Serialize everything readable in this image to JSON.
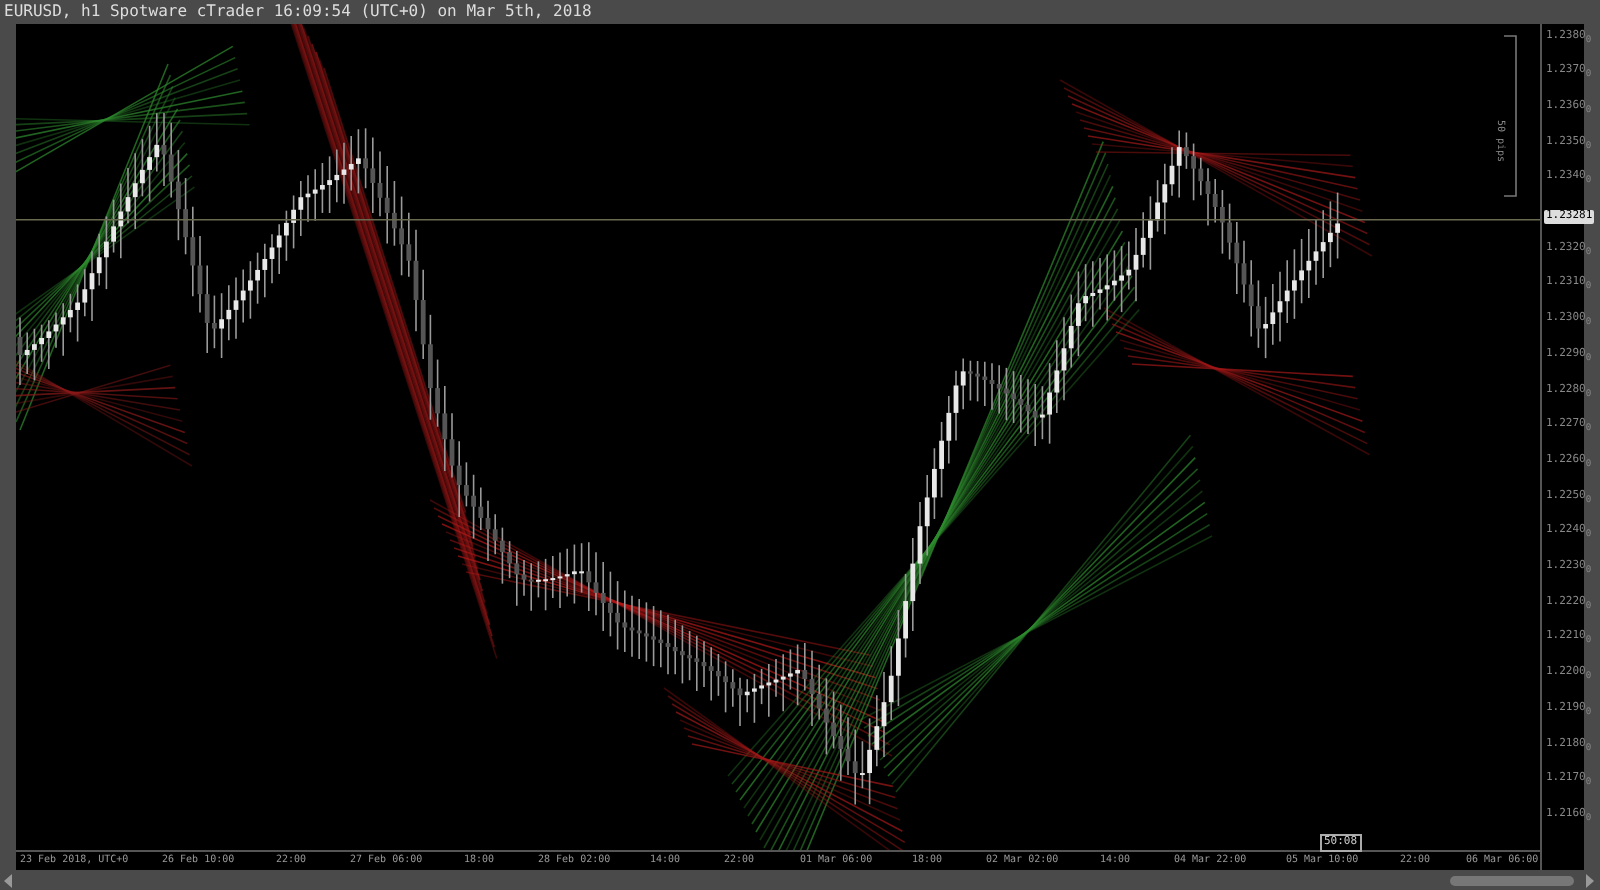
{
  "window": {
    "title": "EURUSD, h1 Spotware cTrader 16:09:54 (UTC+0) on Mar 5th, 2018"
  },
  "chart": {
    "ruler_label": "50 pips",
    "current_price": "1.23281",
    "countdown": "50:08",
    "price_axis": [
      "1.2380$_{0}$",
      "1.2370$_{0}$",
      "1.2360$_{0}$",
      "1.2350$_{0}$",
      "1.2340$_{0}$",
      "1.2320$_{0}$",
      "1.2310$_{0}$",
      "1.2300$_{0}$",
      "1.2290$_{0}$",
      "1.2280$_{0}$",
      "1.2270$_{0}$",
      "1.2260$_{0}$",
      "1.2250$_{0}$",
      "1.2240$_{0}$",
      "1.2230$_{0}$",
      "1.2220$_{0}$",
      "1.2210$_{0}$",
      "1.2200$_{0}$",
      "1.2190$_{0}$",
      "1.2180$_{0}$",
      "1.2170$_{0}$",
      "1.2160$_{0}$"
    ],
    "time_axis": [
      "23 Feb 2018, UTC+0",
      "26 Feb 10:00",
      "22:00",
      "27 Feb 06:00",
      "18:00",
      "28 Feb 02:00",
      "14:00",
      "22:00",
      "01 Mar 06:00",
      "18:00",
      "02 Mar 02:00",
      "14:00",
      "04 Mar 22:00",
      "05 Mar 10:00",
      "22:00",
      "06 Mar 06:00"
    ]
  }
}
